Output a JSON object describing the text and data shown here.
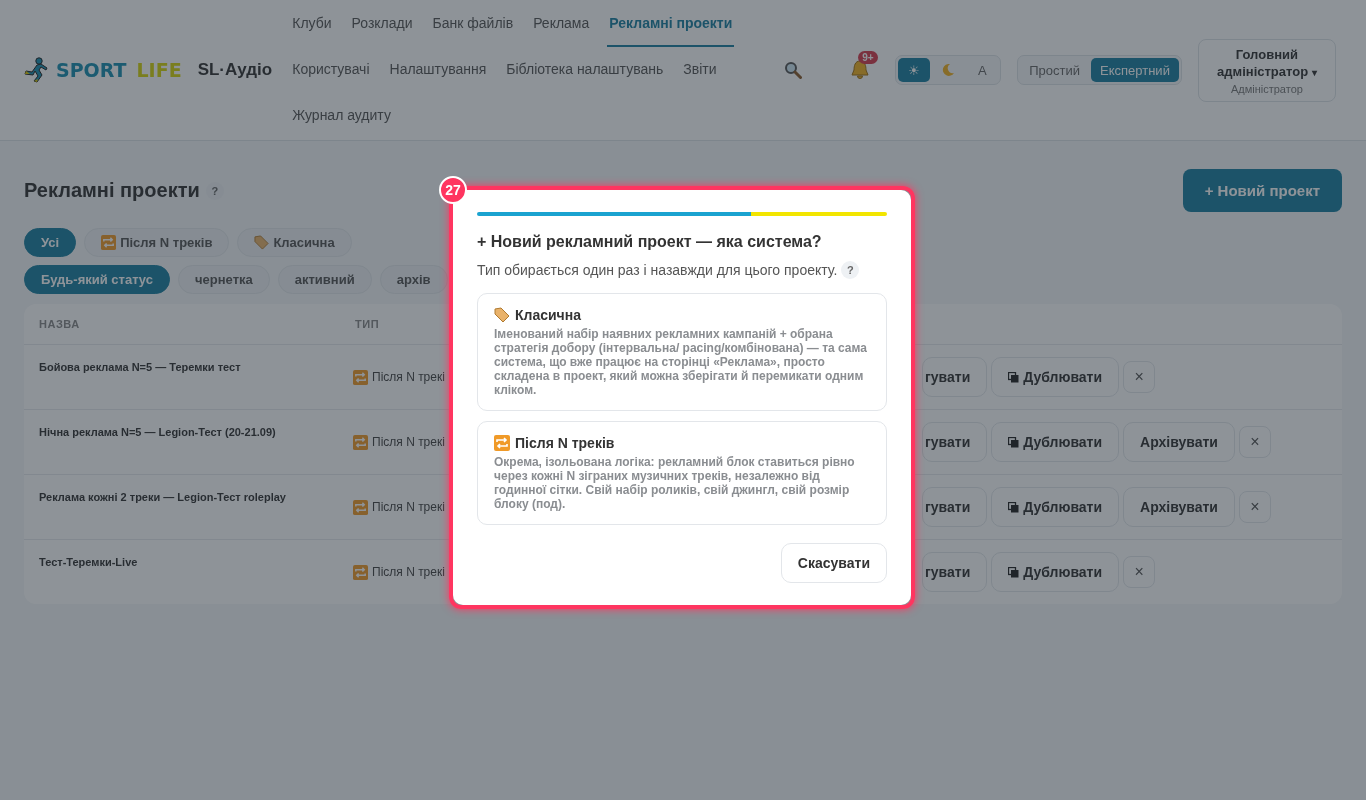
{
  "header": {
    "logo": {
      "word_1": "SPORT",
      "word_2": "LIFE"
    },
    "app_name": "SL·Аудіо",
    "nav": [
      {
        "label": "Клуби",
        "selected": false
      },
      {
        "label": "Розклади",
        "selected": false
      },
      {
        "label": "Банк файлів",
        "selected": false
      },
      {
        "label": "Реклама",
        "selected": false
      },
      {
        "label": "Рекламні проекти",
        "selected": true
      },
      {
        "label": "Користувачі",
        "selected": false
      },
      {
        "label": "Налаштування",
        "selected": false
      },
      {
        "label": "Бібліотека налаштувань",
        "selected": false
      },
      {
        "label": "Звіти",
        "selected": false
      },
      {
        "label": "Журнал аудиту",
        "selected": false
      }
    ],
    "notifications_badge": "9+",
    "theme_toggle": [
      {
        "kind": "light",
        "label": "☀",
        "selected": true
      },
      {
        "kind": "dark",
        "selected": false
      },
      {
        "kind": "auto",
        "label": "A",
        "selected": false
      }
    ],
    "mode_toggle": [
      {
        "label": "Простий",
        "selected": false
      },
      {
        "label": "Експертний",
        "selected": true
      }
    ],
    "user": {
      "name": "Головний адміністратор",
      "caret": "▾",
      "role": "Адміністратор"
    }
  },
  "page": {
    "title": "Рекламні проекти",
    "help": "?",
    "new_button": "+ Новий проект",
    "type_filters": [
      {
        "label": "Усі",
        "selected": true
      },
      {
        "kind": "after_n",
        "label": "Після N треків",
        "selected": false
      },
      {
        "kind": "classic",
        "label": "Класична",
        "selected": false
      }
    ],
    "status_filters": [
      {
        "label": "Будь-який статус",
        "selected": true
      },
      {
        "label": "чернетка",
        "selected": false
      },
      {
        "label": "активний",
        "selected": false
      },
      {
        "label": "архів",
        "selected": false
      }
    ],
    "table": {
      "columns": [
        "НАЗВА",
        "ТИП"
      ],
      "rows": [
        {
          "name": "Бойова реклама N=5 — Теремки тест",
          "type": {
            "kind": "after_n",
            "label": "Після N трекі"
          },
          "actions": [
            {
              "kind": "text",
              "label": "гувати"
            },
            {
              "kind": "duplicate",
              "label": "Дублювати"
            },
            {
              "kind": "close",
              "label": "×"
            }
          ]
        },
        {
          "name": "Нічна реклама N=5 — Legion-Тест (20-21.09)",
          "type": {
            "kind": "after_n",
            "label": "Після N трекі"
          },
          "actions": [
            {
              "kind": "text",
              "label": "гувати"
            },
            {
              "kind": "duplicate",
              "label": "Дублювати"
            },
            {
              "kind": "text",
              "label": "Архівувати"
            },
            {
              "kind": "close",
              "label": "×"
            }
          ]
        },
        {
          "name": "Реклама кожні 2 треки — Legion-Тест roleplay",
          "type": {
            "kind": "after_n",
            "label": "Після N трекі"
          },
          "actions": [
            {
              "kind": "text",
              "label": "гувати"
            },
            {
              "kind": "duplicate",
              "label": "Дублювати"
            },
            {
              "kind": "text",
              "label": "Архівувати"
            },
            {
              "kind": "close",
              "label": "×"
            }
          ]
        },
        {
          "name": "Тест-Теремки-Live",
          "type": {
            "kind": "after_n",
            "label": "Після N трекі"
          },
          "actions": [
            {
              "kind": "text",
              "label": "гувати"
            },
            {
              "kind": "duplicate",
              "label": "Дублювати"
            },
            {
              "kind": "close",
              "label": "×"
            }
          ]
        }
      ]
    }
  },
  "modal": {
    "step_badge": "27",
    "title": "+ Новий рекламний проект — яка система?",
    "subtitle": "Тип обирається один раз і назавжди для цього проекту.",
    "help": "?",
    "options": [
      {
        "kind": "classic",
        "title": "Класична",
        "description": "Іменований набір наявних рекламних кампаній + обрана стратегія добору (інтервальна/ pacing/комбінована) — та сама система, що вже працює на сторінці «Реклама», просто складена в проект, який можна зберігати й перемикати одним кліком."
      },
      {
        "kind": "after_n",
        "title": "Після N треків",
        "description": "Окрема, ізольована логіка: рекламний блок ставиться рівно через кожні N зіграних музичних треків, незалежно від годинної сітки. Свій набір роликів, свій джингл, свій розмір блоку (под)."
      }
    ],
    "cancel_button": "Скасувати"
  }
}
